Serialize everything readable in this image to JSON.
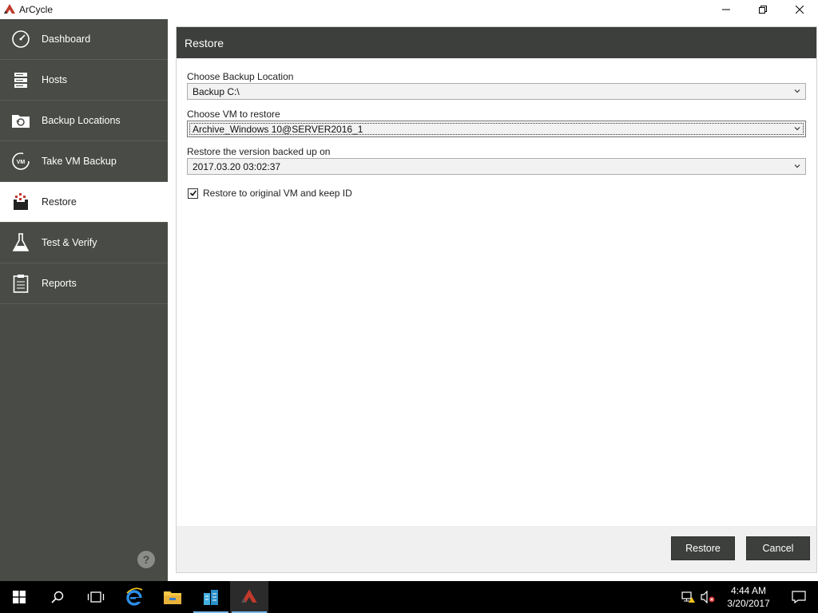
{
  "window": {
    "title": "ArCycle"
  },
  "sidebar": {
    "items": [
      {
        "label": "Dashboard",
        "icon": "dashboard-gauge-icon"
      },
      {
        "label": "Hosts",
        "icon": "server-rack-icon"
      },
      {
        "label": "Backup Locations",
        "icon": "folder-backup-icon"
      },
      {
        "label": "Take VM Backup",
        "icon": "vm-backup-icon"
      },
      {
        "label": "Restore",
        "icon": "restore-icon",
        "active": true
      },
      {
        "label": "Test & Verify",
        "icon": "flask-icon"
      },
      {
        "label": "Reports",
        "icon": "clipboard-icon"
      }
    ],
    "help_label": "?"
  },
  "panel": {
    "title": "Restore",
    "backup_location": {
      "label": "Choose Backup Location",
      "value": "Backup  C:\\"
    },
    "vm": {
      "label": "Choose VM to restore",
      "value": "Archive_Windows 10@SERVER2016_1"
    },
    "version": {
      "label": "Restore the version backed up on",
      "value": "2017.03.20 03:02:37"
    },
    "keep_id": {
      "label": "Restore to original VM and keep ID",
      "checked": true
    },
    "restore_button": "Restore",
    "cancel_button": "Cancel"
  },
  "taskbar": {
    "time": "4:44 AM",
    "date": "3/20/2017"
  },
  "colors": {
    "sidebar_bg": "#484b46",
    "header_bg": "#3d3f3c",
    "accent_red": "#c0392b"
  }
}
